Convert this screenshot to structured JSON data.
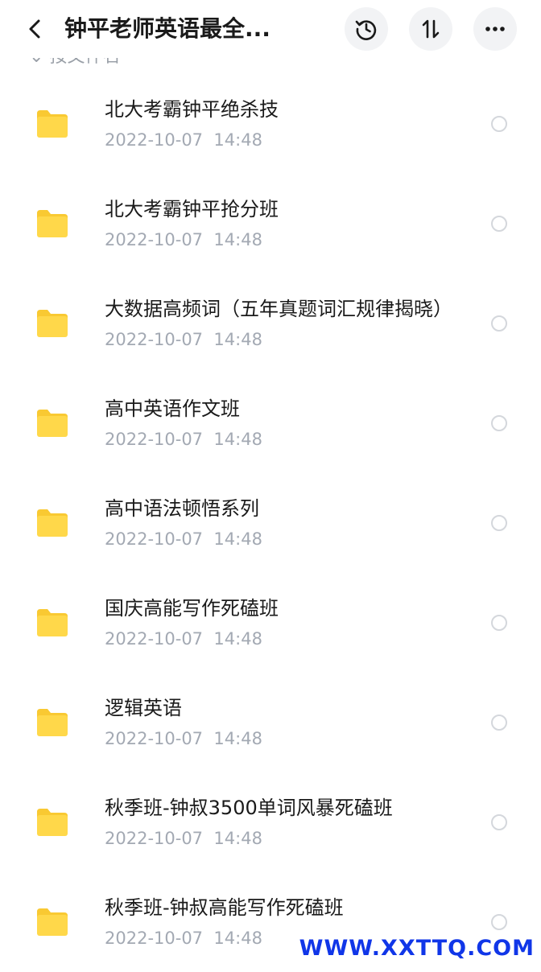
{
  "header": {
    "title": "钟平老师英语最全...",
    "back_icon": "chevron-left-icon",
    "actions": [
      {
        "name": "history-button",
        "icon": "history-icon"
      },
      {
        "name": "sort-button",
        "icon": "sort-icon"
      },
      {
        "name": "more-button",
        "icon": "more-icon"
      }
    ]
  },
  "partial_header_text": "按文件名",
  "colors": {
    "folder": "#FFD84A",
    "folder_tab": "#F9C932",
    "meta_text": "#A3A9B3",
    "icon_button_bg": "#F2F3F5",
    "watermark": "#1036E8"
  },
  "items": [
    {
      "name": "北大考霸钟平绝杀技",
      "date": "2022-10-07",
      "time": "14:48"
    },
    {
      "name": "北大考霸钟平抢分班",
      "date": "2022-10-07",
      "time": "14:48"
    },
    {
      "name": "大数据高频词（五年真题词汇规律揭晓）",
      "date": "2022-10-07",
      "time": "14:48"
    },
    {
      "name": "高中英语作文班",
      "date": "2022-10-07",
      "time": "14:48"
    },
    {
      "name": "高中语法顿悟系列",
      "date": "2022-10-07",
      "time": "14:48"
    },
    {
      "name": "国庆高能写作死磕班",
      "date": "2022-10-07",
      "time": "14:48"
    },
    {
      "name": "逻辑英语",
      "date": "2022-10-07",
      "time": "14:48"
    },
    {
      "name": "秋季班-钟叔3500单词风暴死磕班",
      "date": "2022-10-07",
      "time": "14:48"
    },
    {
      "name": "秋季班-钟叔高能写作死磕班",
      "date": "2022-10-07",
      "time": "14:48"
    }
  ],
  "watermark": "WWW.XXTTQ.COM"
}
